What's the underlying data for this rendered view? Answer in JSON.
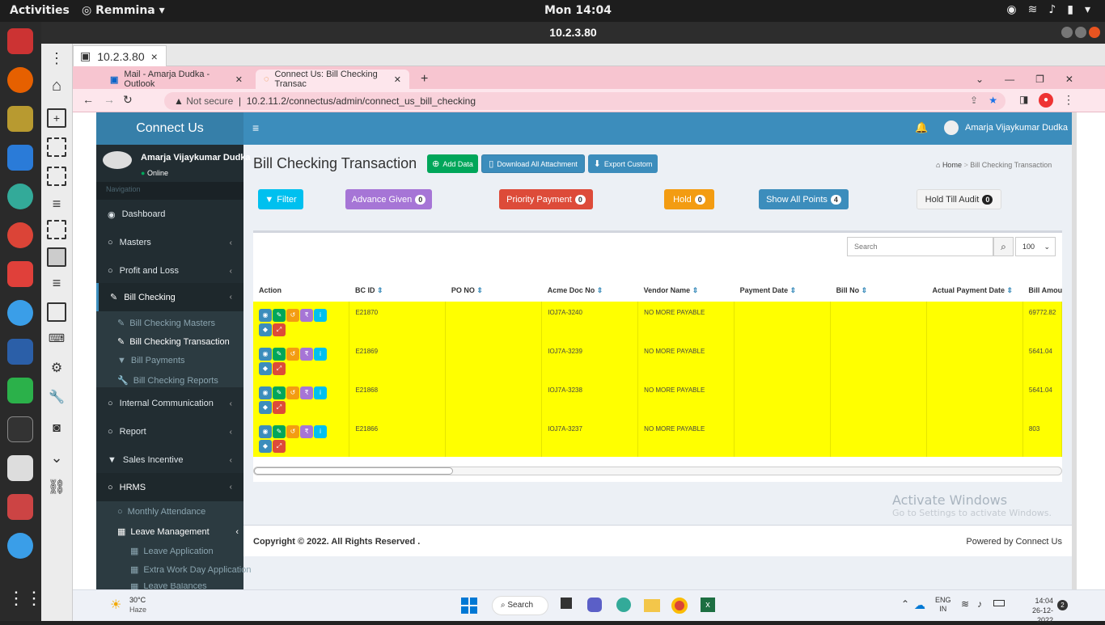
{
  "topbar": {
    "activities": "Activities",
    "app": "Remmina",
    "clock": "Mon 14:04"
  },
  "remmina": {
    "title": "10.2.3.80",
    "tab": "10.2.3.80"
  },
  "browser": {
    "tabs": [
      {
        "label": "Mail - Amarja Dudka - Outlook"
      },
      {
        "label": "Connect Us: Bill Checking Transac"
      }
    ],
    "security": "Not secure",
    "url": "10.2.11.2/connectus/admin/connect_us_bill_checking"
  },
  "app": {
    "logo": "Connect Us",
    "user": "Amarja Vijaykumar Dudka",
    "status": "Online",
    "nav_header": "Navigation"
  },
  "nav": [
    "Dashboard",
    "Masters",
    "Profit and Loss",
    "Bill Checking",
    "Internal Communication",
    "Report",
    "Sales Incentive",
    "HRMS"
  ],
  "nav_sub": [
    "Bill Checking Masters",
    "Bill Checking Transaction",
    "Bill Payments",
    "Bill Checking Reports",
    "Monthly Attendance",
    "Leave Management",
    "Leave Application",
    "Extra Work Day Application",
    "Leave Balances"
  ],
  "page": {
    "title": "Bill Checking Transaction",
    "add": "Add Data",
    "download": "Download All Attachment",
    "export": "Export Custom",
    "home": "Home",
    "crumb": "Bill Checking Transaction"
  },
  "filters": {
    "filter": "Filter",
    "advance": "Advance Given",
    "advance_n": "0",
    "priority": "Priority Payment",
    "priority_n": "0",
    "hold": "Hold",
    "hold_n": "0",
    "show_all": "Show All Points",
    "show_all_n": "4",
    "hold_audit": "Hold Till Audit",
    "hold_audit_n": "0"
  },
  "table": {
    "search_placeholder": "Search",
    "page_size": "100",
    "headers": [
      "Action",
      "BC ID",
      "PO NO",
      "Acme Doc No",
      "Vendor Name",
      "Payment Date",
      "Bill No",
      "Actual Payment Date",
      "Bill Amour"
    ],
    "rows": [
      {
        "bc": "E21870",
        "po": "",
        "acme": "IOJ7A-3240",
        "vendor": "NO MORE PAYABLE",
        "amount": "69772.82"
      },
      {
        "bc": "E21869",
        "po": "",
        "acme": "IOJ7A-3239",
        "vendor": "NO MORE PAYABLE",
        "amount": "5641.04"
      },
      {
        "bc": "E21868",
        "po": "",
        "acme": "IOJ7A-3238",
        "vendor": "NO MORE PAYABLE",
        "amount": "5641.04"
      },
      {
        "bc": "E21866",
        "po": "",
        "acme": "IOJ7A-3237",
        "vendor": "NO MORE PAYABLE",
        "amount": "803"
      }
    ]
  },
  "footer": {
    "copyright": "Copyright © 2022. All Rights Reserved .",
    "powered": "Powered by Connect Us"
  },
  "watermark": {
    "line1": "Activate Windows",
    "line2": "Go to Settings to activate Windows."
  },
  "taskbar": {
    "temp": "30°C",
    "weather": "Haze",
    "search": "Search",
    "lang1": "ENG",
    "lang2": "IN",
    "time": "14:04",
    "date": "26-12-2022",
    "notif": "2"
  }
}
